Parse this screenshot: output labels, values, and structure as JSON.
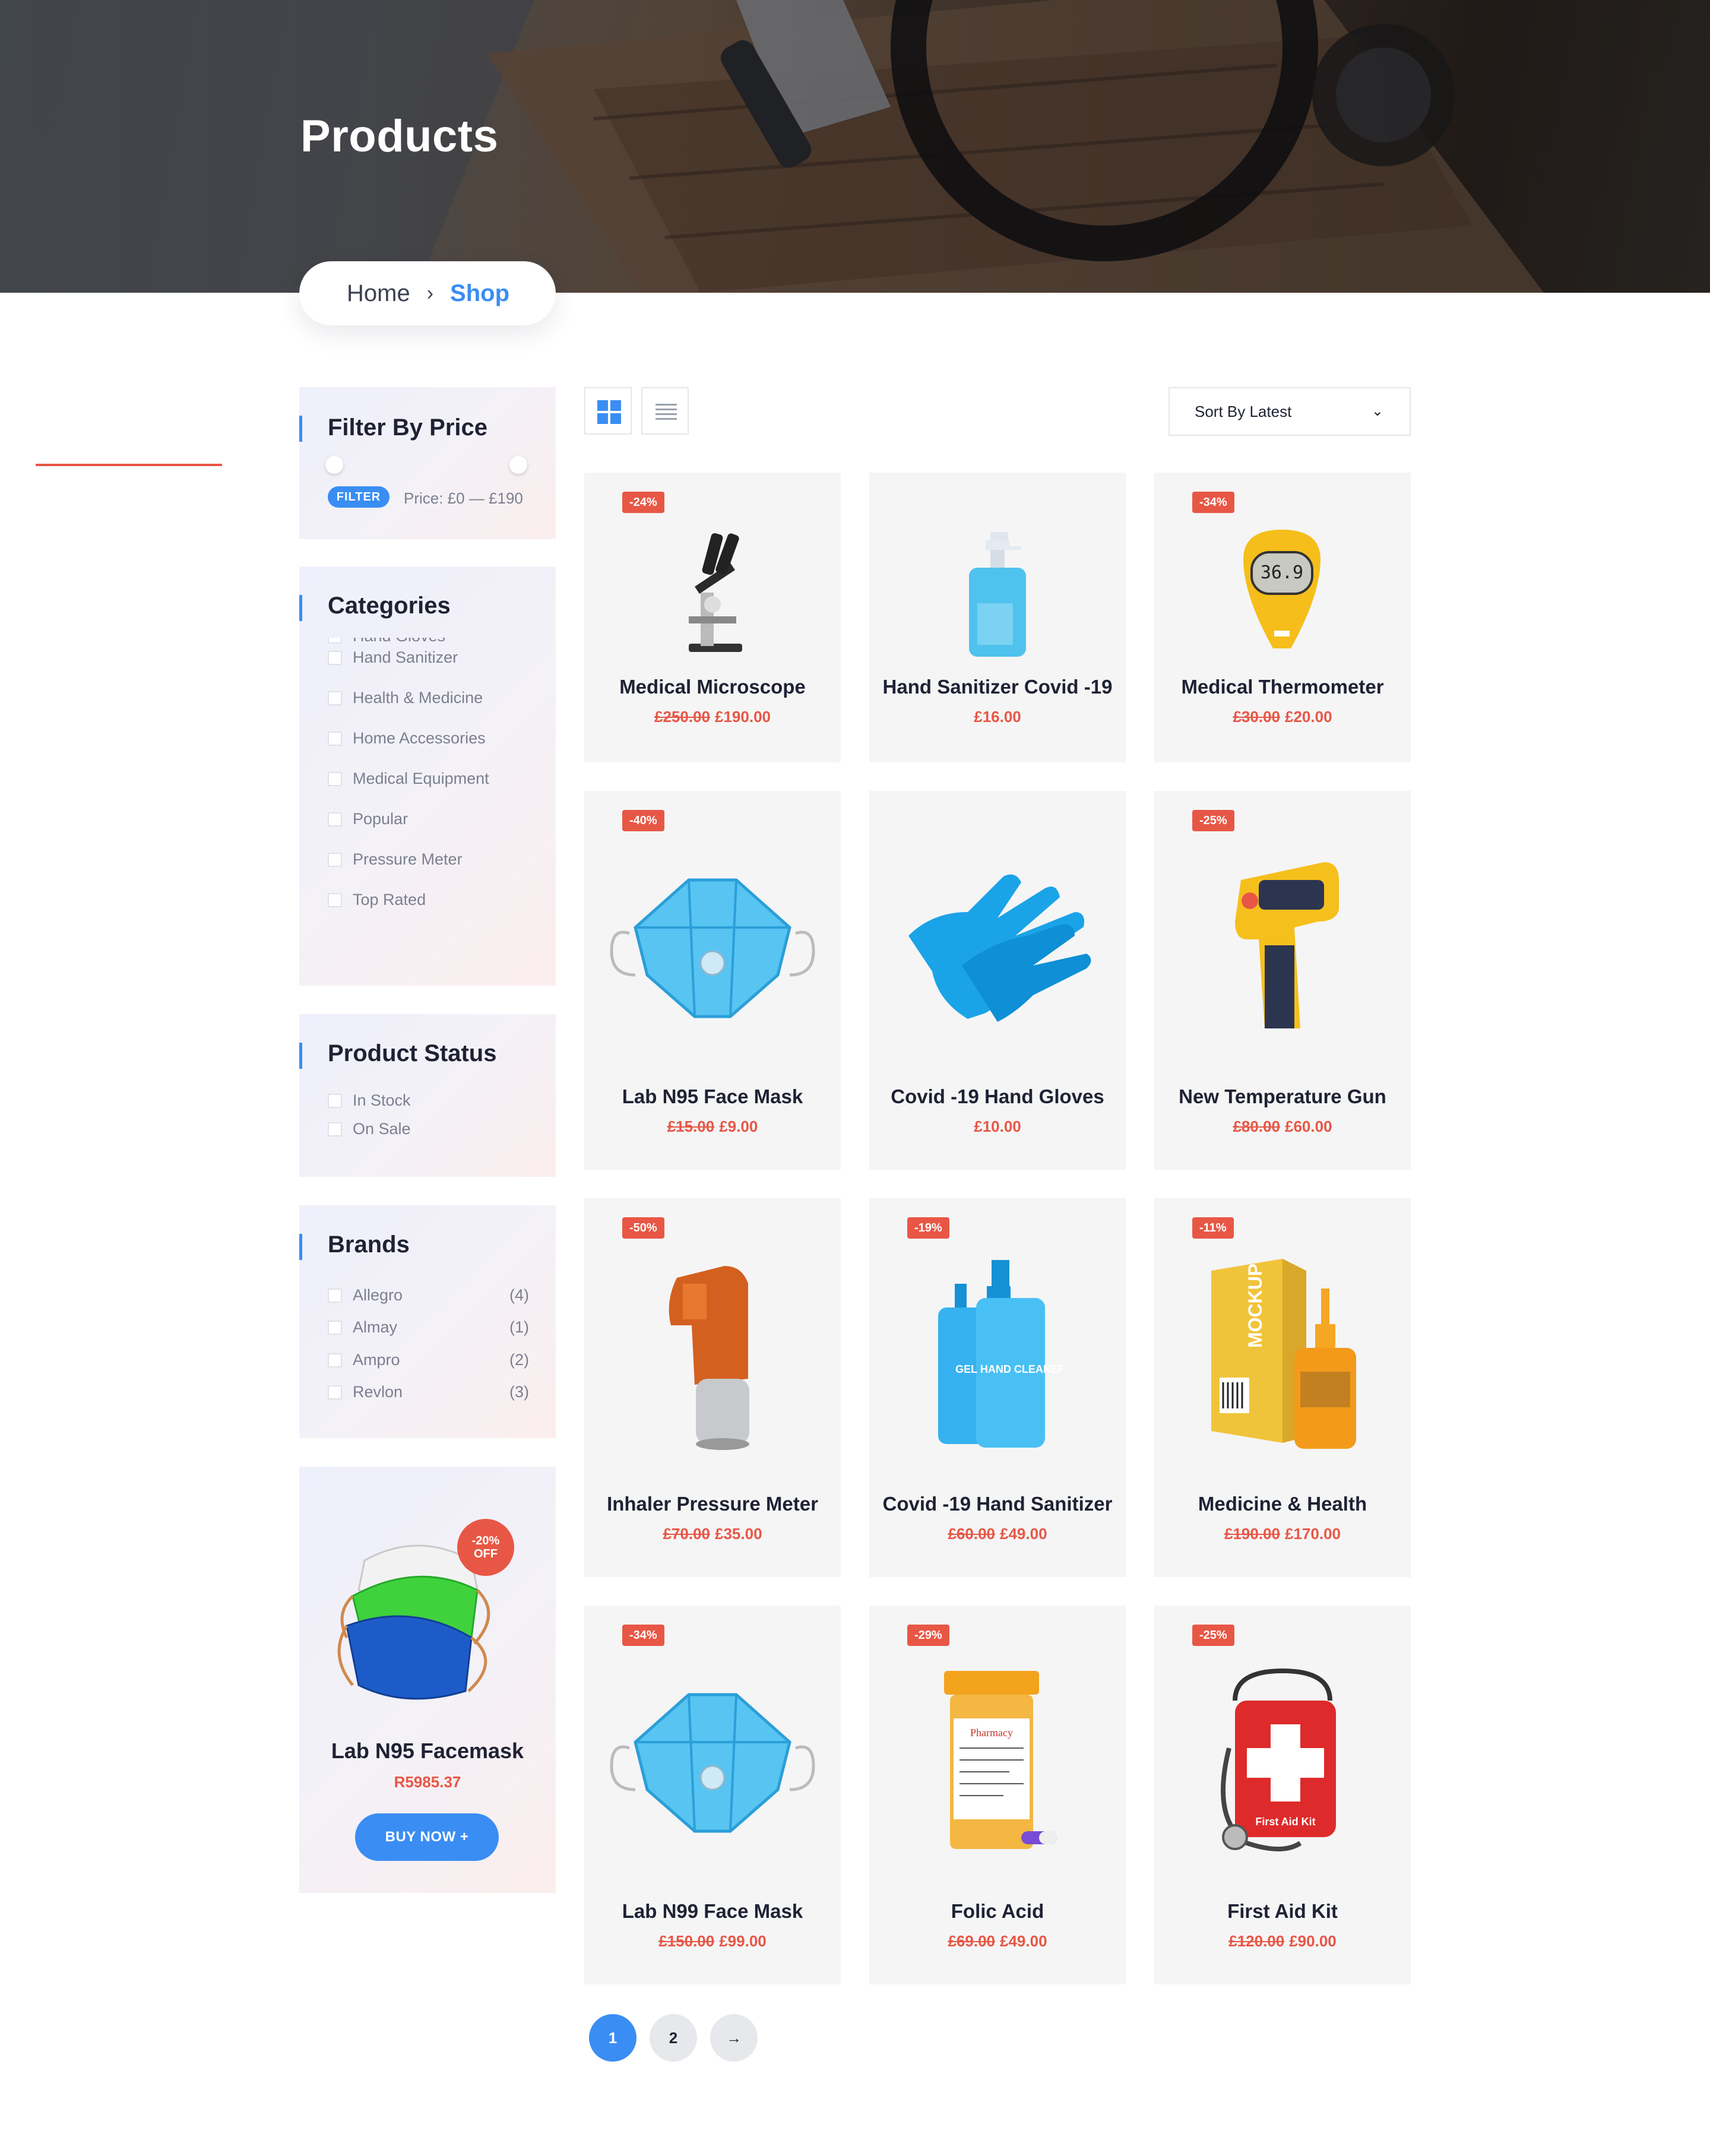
{
  "hero": {
    "title": "Products"
  },
  "breadcrumb": {
    "home": "Home",
    "separator": "›",
    "current": "Shop"
  },
  "sidebar": {
    "price_filter": {
      "title": "Filter By Price",
      "button": "FILTER",
      "price_text": "Price: £0 — £190"
    },
    "categories": {
      "title": "Categories",
      "items": [
        "Hand Gloves",
        "Hand Sanitizer",
        "Health & Medicine",
        "Home Accessories",
        "Medical Equipment",
        "Popular",
        "Pressure Meter",
        "Top Rated"
      ]
    },
    "product_status": {
      "title": "Product Status",
      "items": [
        "In Stock",
        "On Sale"
      ]
    },
    "brands": {
      "title": "Brands",
      "items": [
        {
          "name": "Allegro",
          "count": "(4)"
        },
        {
          "name": "Almay",
          "count": "(1)"
        },
        {
          "name": "Ampro",
          "count": "(2)"
        },
        {
          "name": "Revlon",
          "count": "(3)"
        }
      ]
    },
    "promo": {
      "badge_pct": "-20%",
      "badge_off": "OFF",
      "title": "Lab N95 Facemask",
      "price": "R5985.37",
      "button": "BUY NOW  +"
    }
  },
  "toolbar": {
    "sort_label": "Sort By Latest",
    "chevron": "⌄"
  },
  "products": [
    {
      "badge": "-24%",
      "name": "Medical Microscope",
      "old_price": "£250.00",
      "price": "£190.00",
      "icon": "microscope-icon"
    },
    {
      "badge": "",
      "name": "Hand Sanitizer Covid -19",
      "old_price": "",
      "price": "£16.00",
      "icon": "sanitizer-bottle-icon"
    },
    {
      "badge": "-34%",
      "name": "Medical Thermometer",
      "old_price": "£30.00",
      "price": "£20.00",
      "icon": "thermometer-icon",
      "display": "36.9"
    },
    {
      "badge": "-40%",
      "name": "Lab N95 Face Mask",
      "old_price": "£15.00",
      "price": "£9.00",
      "icon": "face-mask-icon"
    },
    {
      "badge": "",
      "name": "Covid -19 Hand Gloves",
      "old_price": "",
      "price": "£10.00",
      "icon": "gloves-icon"
    },
    {
      "badge": "-25%",
      "name": "New Temperature Gun",
      "old_price": "£80.00",
      "price": "£60.00",
      "icon": "temperature-gun-icon"
    },
    {
      "badge": "-50%",
      "name": "Inhaler Pressure Meter",
      "old_price": "£70.00",
      "price": "£35.00",
      "icon": "inhaler-icon"
    },
    {
      "badge": "-19%",
      "name": "Covid -19 Hand Sanitizer",
      "old_price": "£60.00",
      "price": "£49.00",
      "icon": "sanitizer-pair-icon",
      "label": "GEL HAND CLEANER"
    },
    {
      "badge": "-11%",
      "name": "Medicine & Health",
      "old_price": "£190.00",
      "price": "£170.00",
      "icon": "medicine-box-icon",
      "label": "MOCKUP"
    },
    {
      "badge": "-34%",
      "name": "Lab N99 Face Mask",
      "old_price": "£150.00",
      "price": "£99.00",
      "icon": "face-mask-icon"
    },
    {
      "badge": "-29%",
      "name": "Folic Acid",
      "old_price": "£69.00",
      "price": "£49.00",
      "icon": "pill-bottle-icon",
      "label": "Pharmacy"
    },
    {
      "badge": "-25%",
      "name": "First Aid Kit",
      "old_price": "£120.00",
      "price": "£90.00",
      "icon": "first-aid-kit-icon",
      "label": "First Aid Kit"
    }
  ],
  "pagination": {
    "pages": [
      "1",
      "2"
    ],
    "next": "→",
    "active": "1"
  },
  "colors": {
    "accent": "#3a8df3",
    "sale": "#e85745",
    "card_bg": "#f5f5f6"
  }
}
